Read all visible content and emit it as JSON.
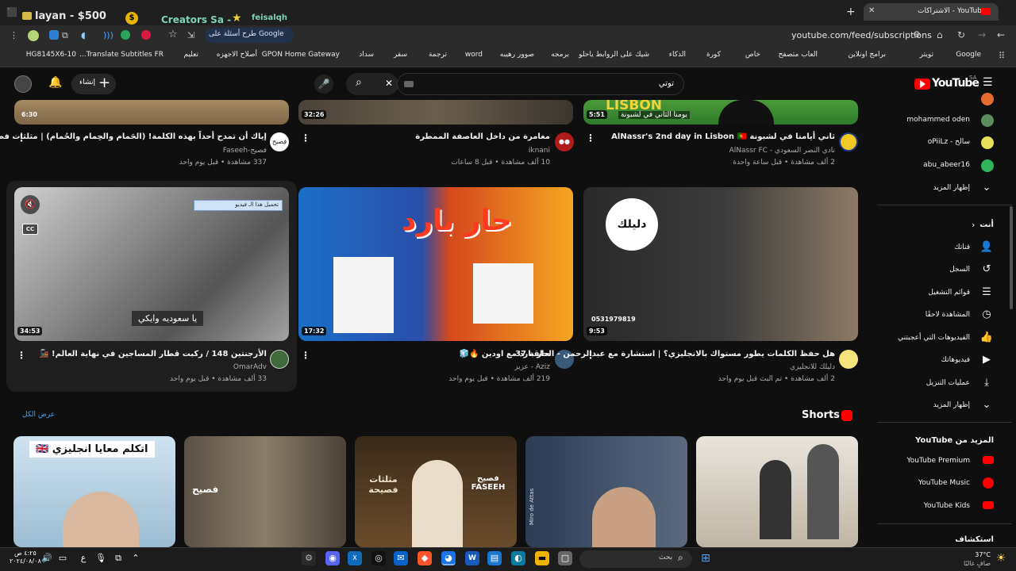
{
  "tabs": {
    "left_group1": "layan - $500",
    "left_group2": "Creators Sa -",
    "left_group3": "feisalqh",
    "active": "الاشتراكات - YouTube"
  },
  "address": {
    "url": "youtube.com/feed/subscriptions",
    "google_lens": "طرح أسئلة على Google"
  },
  "bookmarks": [
    "Google",
    "تويتر",
    "برامج اونلاين",
    "العاب متصفح",
    "خاص",
    "كورة",
    "الذكاء",
    "شيك على الروابط ياحلو",
    "برمجه",
    "صوور رهيبه",
    "word",
    "ترجمة",
    "سفر",
    "سداد",
    "GPON Home Gateway",
    "أصلاح الاجهزه",
    "تعليم",
    "Translate Subtitles FR...",
    "HG8145X6-10"
  ],
  "header": {
    "logo": "YouTube",
    "region": "SA",
    "search_value": "توتي",
    "create_label": "إنشاء"
  },
  "videos": [
    {
      "duration": "6:30",
      "title": "إياك أن تمدح أحداً بهذه الكلمة! (الحَمام والحِمام والحُمام) | مثلثات فصيحة (17)",
      "channel": "فصيح-Faseeh",
      "meta": "337 مشاهدة • قبل يوم واحد"
    },
    {
      "duration": "32:26",
      "title": "مغامرة من داخل العاصفة الممطرة",
      "channel": "iknani",
      "meta": "10 آلف مشاهدة • قبل 8 ساعات"
    },
    {
      "duration": "5:51",
      "title": "ثاني أيامنا في لشبونة AlNassr's 2nd day in Lisbon 🇵🇹",
      "channel": "نادي النصر السعودي - AlNassr FC",
      "meta": "2 ألف مشاهدة • قبل ساعة واحدة",
      "overlay_caption": "يومنا الثاني في لشبونة",
      "overlay_word": "LISBON"
    },
    {
      "duration": "34:53",
      "title": "الأرجنتين 148 / ركبت قطار المساجين في نهاية العالم! 🚂",
      "channel": "OmarAdv",
      "meta": "33 ألف مشاهدة • قبل يوم واحد",
      "caption": "يا سعوديه وايكي",
      "download_label": "تحميل هذا الـ فيديو"
    },
    {
      "duration": "17:32",
      "title": "حار بارد مع اودين 🔥🧊",
      "channel": "Aziz - عزيز",
      "meta": "219 ألف مشاهدة • قبل يوم واحد",
      "overlay": "حار بارد"
    },
    {
      "duration": "9:53",
      "title": "هل حفظ الكلمات يطور مستواك بالانجليزي؟ | استشارة مع عبدالرحمن - الحلقة 37",
      "channel": "دليلك للانجليزي",
      "meta": "2 ألف مشاهدة • تم البث قبل يوم واحد",
      "phone": "0531979819",
      "logo_text": "دليلك"
    }
  ],
  "sidebar": {
    "subs": [
      "mohammed oden",
      "سالح - oPiiLz",
      "abu_abeer16"
    ],
    "show_more": "إظهار المزيد",
    "you_title": "أنت",
    "you_items": [
      "قناتك",
      "السجل",
      "قوائم التشغيل",
      "المشاهدة لاحقًا",
      "الفيديوهات التي أعجبتني",
      "فيديوهاتك",
      "عمليات التنزيل",
      "إظهار المزيد"
    ],
    "more_title": "المزيد من YouTube",
    "more_items": [
      "YouTube Premium",
      "YouTube Music",
      "YouTube Kids"
    ],
    "explore": "استكشاف"
  },
  "shorts": {
    "title": "Shorts",
    "view_all": "عرض الكل",
    "s1_caption": "اتكلم معايا انجليزي 🇬🇧",
    "s3_caption": "مثلثات فصيحة",
    "s3_brand": "فصيح FASEEH",
    "s4_label": "Miro de Attas",
    "s2_brand": "فصيح"
  },
  "taskbar": {
    "time": "٤:٢٥ ص",
    "date": "٢٠٢٤/٠٨/٠٨",
    "temp": "37°C",
    "weather": "صافٍ غالبًا",
    "search": "بحث",
    "lang": "ع"
  },
  "colors": {
    "yt_red": "#ff0000",
    "bg": "#0f0f0f",
    "meta": "#aaaaaa"
  }
}
